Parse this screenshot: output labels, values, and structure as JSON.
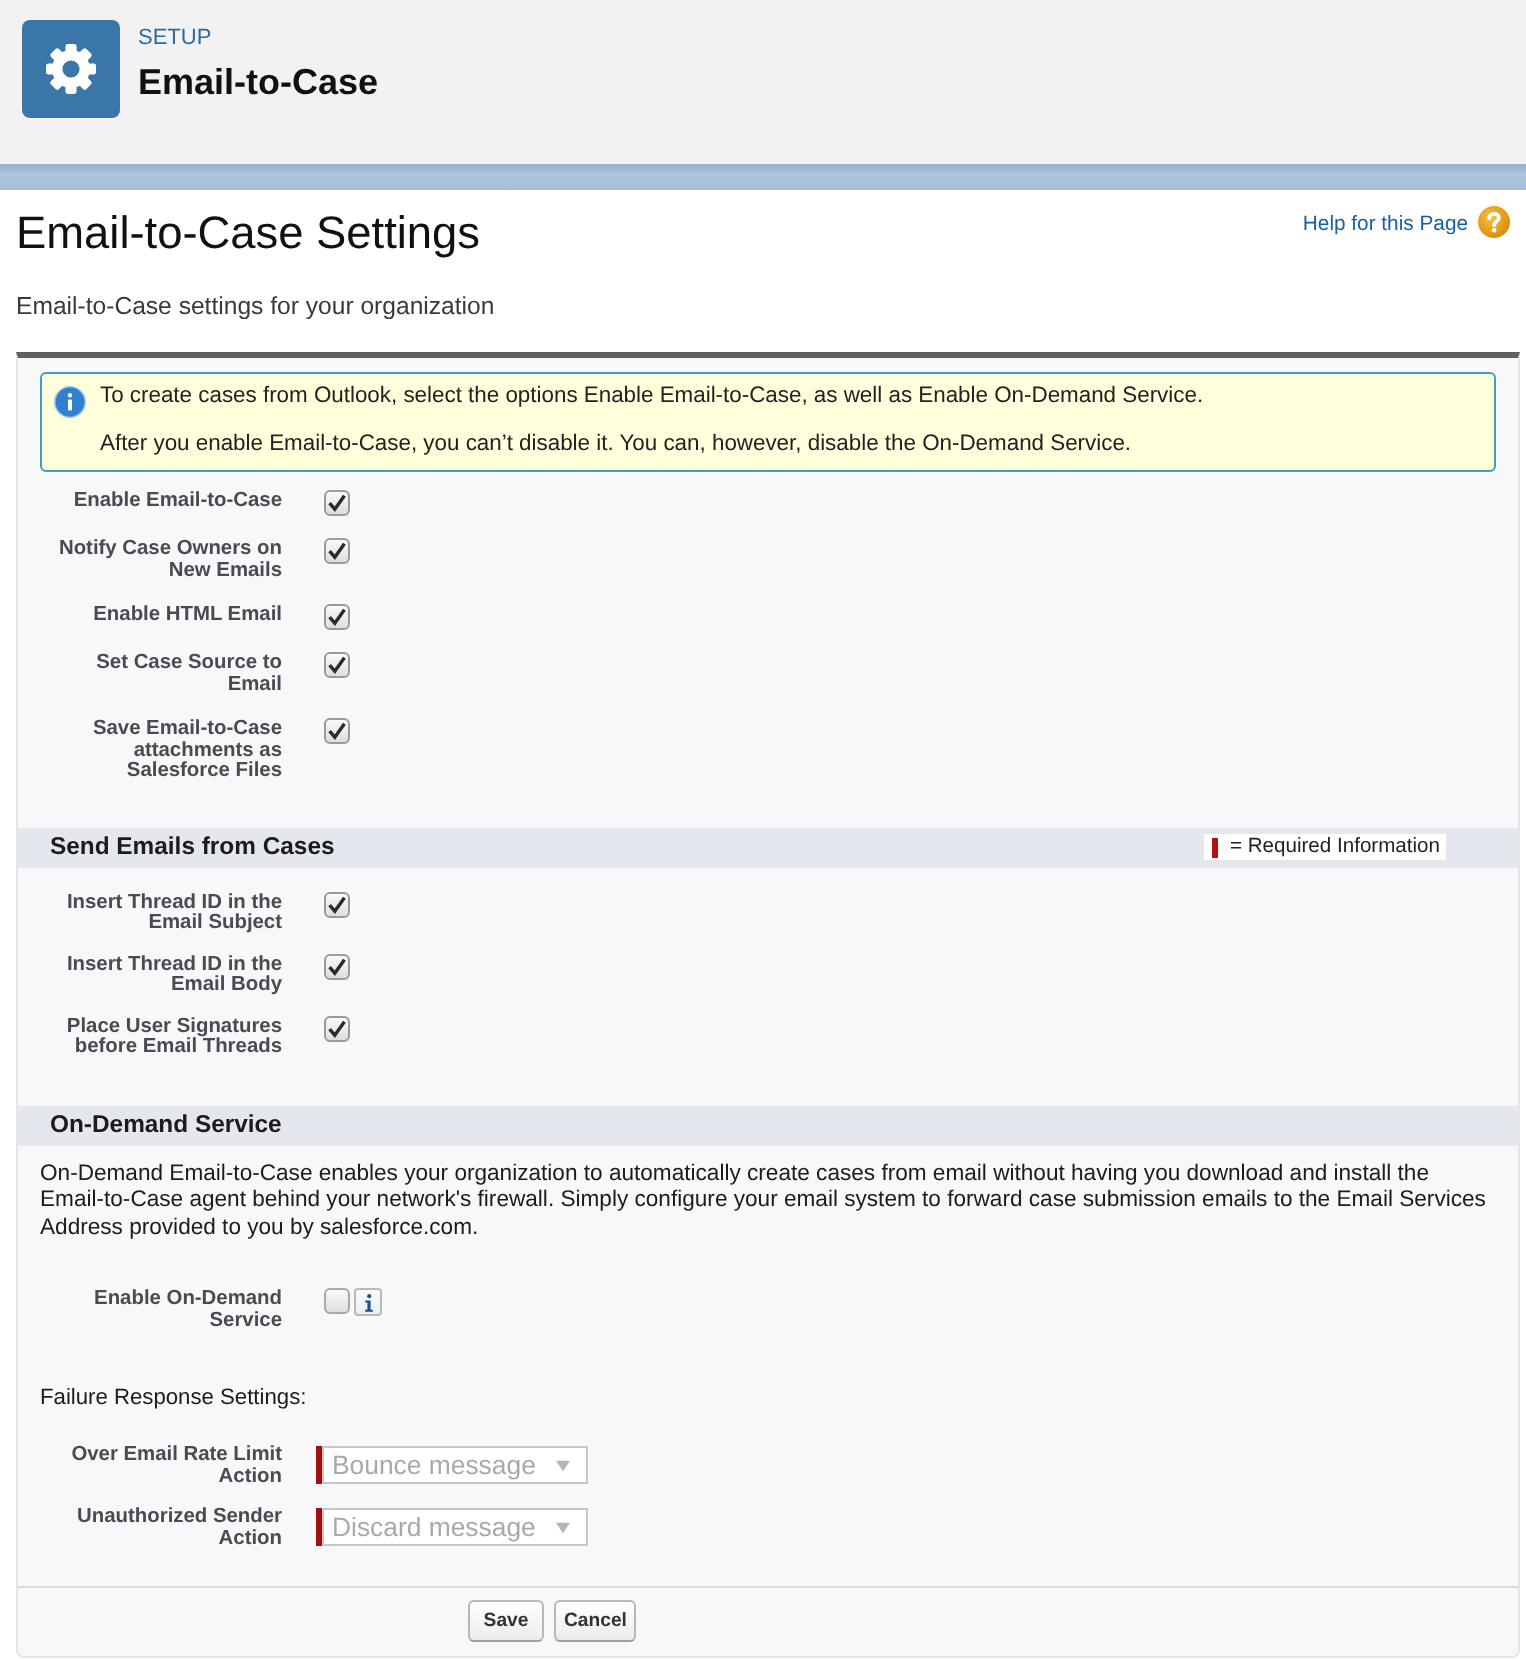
{
  "header": {
    "eyebrow": "SETUP",
    "title": "Email-to-Case"
  },
  "page": {
    "title": "Email-to-Case Settings",
    "help_link": "Help for this Page",
    "description": "Email-to-Case settings for your organization"
  },
  "info_message": [
    "To create cases from Outlook, select the options Enable Email-to-Case, as well as Enable On-Demand Service.",
    "After you enable Email-to-Case, you can’t disable it. You can, however, disable the On-Demand Service."
  ],
  "general_settings": [
    {
      "label": "Enable Email-to-Case",
      "checked": true
    },
    {
      "label": "Notify Case Owners on New Emails",
      "checked": true
    },
    {
      "label": "Enable HTML Email",
      "checked": true
    },
    {
      "label": "Set Case Source to Email",
      "checked": true
    },
    {
      "label": "Save Email-to-Case attachments as Salesforce Files",
      "checked": true
    }
  ],
  "send_emails": {
    "title": "Send Emails from Cases",
    "required_legend": "= Required Information",
    "settings": [
      {
        "label": "Insert Thread ID in the Email Subject",
        "checked": true
      },
      {
        "label": "Insert Thread ID in the Email Body",
        "checked": true
      },
      {
        "label": "Place User Signatures before Email Threads",
        "checked": true
      }
    ]
  },
  "on_demand": {
    "title": "On-Demand Service",
    "description": "On-Demand Email-to-Case enables your organization to automatically create cases from email without having you download and install the Email-to-Case agent behind your network's firewall. Simply configure your email system to forward case submission emails to the Email Services Address provided to you by salesforce.com.",
    "settings": [
      {
        "label": "Enable On-Demand Service",
        "checked": false,
        "info_button": true
      }
    ],
    "failure_response": {
      "title": "Failure Response Settings:",
      "fields": [
        {
          "label": "Over Email Rate Limit Action",
          "value": "Bounce message",
          "required": true,
          "disabled": true
        },
        {
          "label": "Unauthorized Sender Action",
          "value": "Discard message",
          "required": true,
          "disabled": true
        }
      ]
    }
  },
  "buttons": [
    "Save",
    "Cancel"
  ]
}
